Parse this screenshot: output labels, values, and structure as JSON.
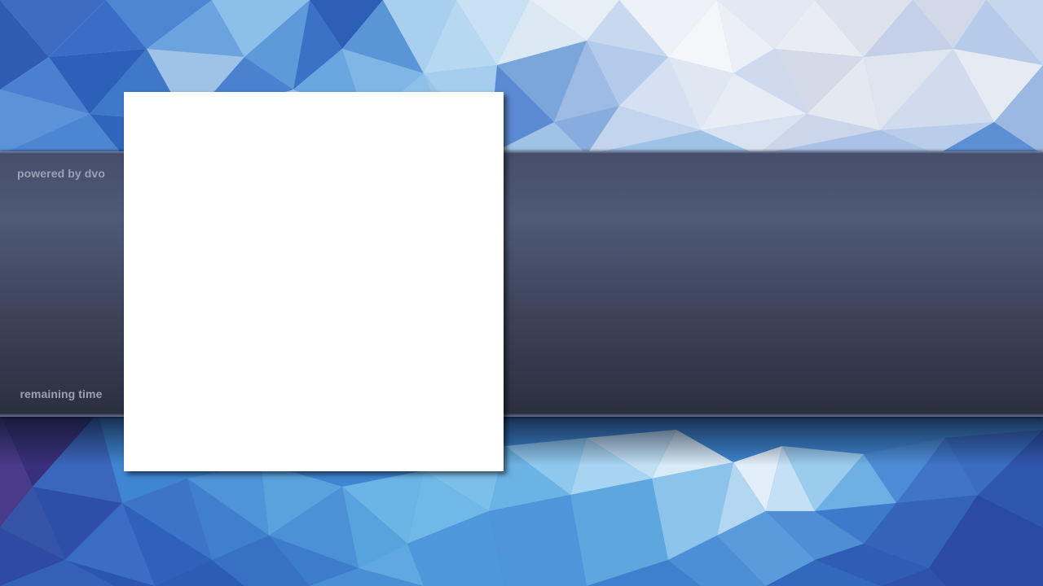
{
  "overlay": {
    "powered_by_text": "powered by dvo",
    "remaining_time_label": "remaining time"
  },
  "colors": {
    "band_top": "#4e5a78",
    "band_bottom": "#2a2f3f",
    "label_text": "#9aa1b6",
    "media_panel": "#ffffff",
    "background_accent": "#4a78c8"
  },
  "icons": {
    "background": "low-poly-pattern"
  }
}
